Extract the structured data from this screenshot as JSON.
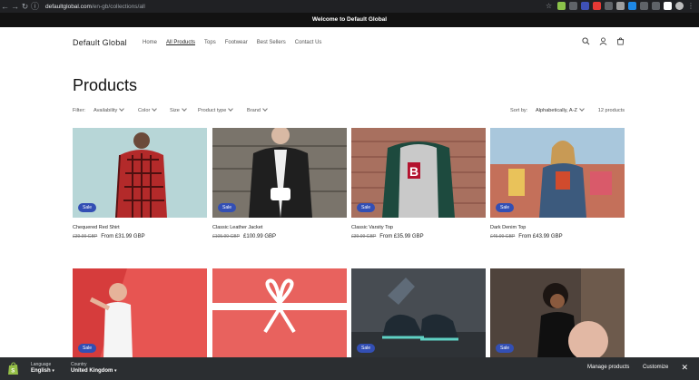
{
  "browser": {
    "url_host": "defaultglobal.com",
    "url_path": "/en-gb/collections/all"
  },
  "announcement": "Welcome to Default Global",
  "header": {
    "logo": "Default Global",
    "nav": [
      "Home",
      "All Products",
      "Tops",
      "Footwear",
      "Best Sellers",
      "Contact Us"
    ],
    "active_nav": "All Products"
  },
  "page_title": "Products",
  "filters": {
    "label": "Filter:",
    "items": [
      "Availability",
      "Color",
      "Size",
      "Product type",
      "Brand"
    ],
    "sort_label": "Sort by:",
    "sort_value": "Alphabetically, A-Z",
    "count": "12 products"
  },
  "products": [
    {
      "name": "Chequered Red Shirt",
      "old_price": "£39.99 GBP",
      "price": "From £31.99 GBP",
      "badge": "Sale"
    },
    {
      "name": "Classic Leather Jacket",
      "old_price": "£105.99 GBP",
      "price": "£100.99 GBP",
      "badge": "Sale"
    },
    {
      "name": "Classic Varsity Top",
      "old_price": "£39.99 GBP",
      "price": "From £35.99 GBP",
      "badge": "Sale"
    },
    {
      "name": "Dark Denim Top",
      "old_price": "£45.99 GBP",
      "price": "From £43.99 GBP",
      "badge": "Sale"
    },
    {
      "badge": "Sale"
    },
    {},
    {
      "badge": "Sale"
    },
    {
      "badge": "Sale"
    }
  ],
  "footer_bar": {
    "language_label": "Language",
    "language_value": "English",
    "country_label": "Country",
    "country_value": "United Kingdom",
    "manage_products": "Manage products",
    "customize": "Customize"
  }
}
